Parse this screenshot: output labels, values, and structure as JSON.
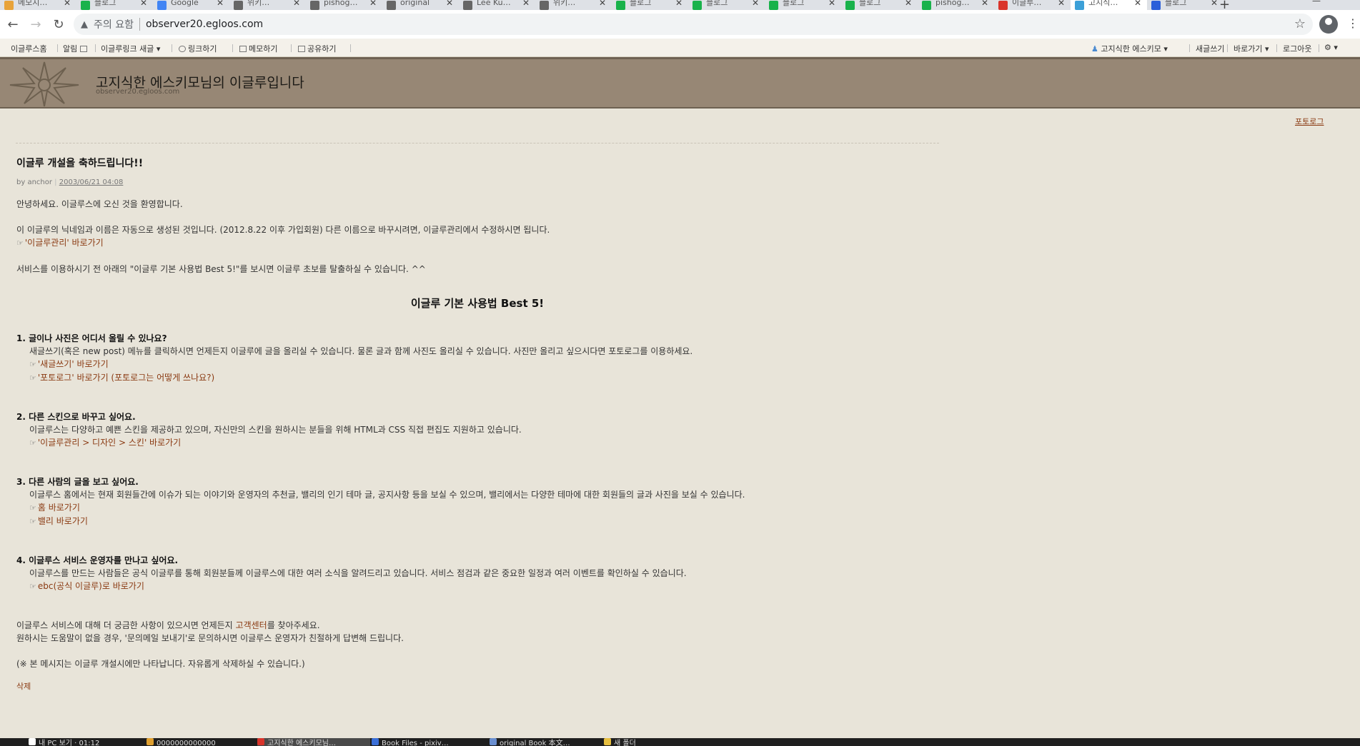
{
  "browser": {
    "tabs": [
      {
        "label": "메모지…",
        "color": "#e8a33a",
        "active": false
      },
      {
        "label": "블로그",
        "color": "#19b24b",
        "active": false
      },
      {
        "label": "Google",
        "color": "#4285f4",
        "active": false
      },
      {
        "label": "위키…",
        "color": "#666666",
        "active": false
      },
      {
        "label": "pishog…",
        "color": "#666666",
        "active": false
      },
      {
        "label": "original",
        "color": "#666666",
        "active": false
      },
      {
        "label": "Lee Ku…",
        "color": "#666666",
        "active": false
      },
      {
        "label": "위키…",
        "color": "#666666",
        "active": false
      },
      {
        "label": "블로그",
        "color": "#19b24b",
        "active": false
      },
      {
        "label": "블로그",
        "color": "#19b24b",
        "active": false
      },
      {
        "label": "블로그",
        "color": "#19b24b",
        "active": false
      },
      {
        "label": "블로그",
        "color": "#19b24b",
        "active": false
      },
      {
        "label": "pishog…",
        "color": "#19b24b",
        "active": false
      },
      {
        "label": "이글루…",
        "color": "#d9342b",
        "active": false
      },
      {
        "label": "고지식…",
        "color": "#3ca0d8",
        "active": true
      },
      {
        "label": "블로그",
        "color": "#2b5fd9",
        "active": false
      }
    ],
    "security_label": "주의 요함",
    "url": "observer20.egloos.com"
  },
  "egloos_bar": {
    "left": [
      "이글루스홈",
      "알림",
      "이글루링크 새글 ▾",
      "링크하기",
      "메모하기",
      "공유하기"
    ],
    "right": [
      "고지식한 에스키모 ▾",
      "새글쓰기",
      "바로가기 ▾",
      "로그아웃",
      "⚙ ▾"
    ]
  },
  "blog": {
    "title": "고지식한 에스키모님의 이글루입니다",
    "subtitle": "observer20.egloos.com",
    "right_link": "포토로그"
  },
  "post": {
    "title": "이글루 개설을 축하드립니다!!",
    "meta_by": "by anchor",
    "meta_date": "2003/06/21 04:08",
    "intro": "안녕하세요. 이글루스에 오신 것을 환영합니다.",
    "nick_note": "이 이글루의 닉네임과 이름은 자동으로 생성된 것입니다. (2012.8.22 이후 가입회원) 다른 이름으로 바꾸시려면, 이글루관리에서 수정하시면 됩니다.",
    "nick_link": "'이글루관리' 바로가기",
    "service_note": "서비스를 이용하시기 전 아래의 \"이글루 기본 사용법 Best 5!\"를 보시면 이글루 초보를 탈출하실 수 있습니다. ^^",
    "best_title": "이글루 기본 사용법 Best 5!",
    "sections": [
      {
        "title": "1. 글이나 사진은 어디서 올릴 수 있나요?",
        "body": "새글쓰기(혹은 new post) 메뉴를 클릭하시면 언제든지 이글루에 글을 올리실 수 있습니다. 물론 글과 함께 사진도 올리실 수 있습니다. 사진만 올리고 싶으시다면 포토로그를 이용하세요.",
        "links": [
          "'새글쓰기' 바로가기",
          "'포토로그' 바로가기 (포토로그는 어떻게 쓰나요?)"
        ]
      },
      {
        "title": "2. 다른 스킨으로 바꾸고 싶어요.",
        "body": "이글루스는 다양하고 예쁜 스킨을 제공하고 있으며, 자신만의 스킨을 원하시는 분들을 위해 HTML과 CSS 직접 편집도 지원하고 있습니다.",
        "links": [
          "'이글루관리 > 디자인 > 스킨' 바로가기"
        ]
      },
      {
        "title": "3. 다른 사람의 글을 보고 싶어요.",
        "body": "이글루스 홈에서는 현재 회원들간에 이슈가 되는 이야기와 운영자의 추천글, 밸리의 인기 테마 글, 공지사항 등을 보실 수 있으며, 밸리에서는 다양한 테마에 대한 회원들의 글과 사진을 보실 수 있습니다.",
        "links": [
          "홈 바로가기",
          "밸리 바로가기"
        ]
      },
      {
        "title": "4. 이글루스 서비스 운영자를 만나고 싶어요.",
        "body": "이글루스를 만드는 사람들은 공식 이글루를 통해 회원분들께 이글루스에 대한 여러 소식을 알려드리고 있습니다. 서비스 점검과 같은 중요한 일정과 여러 이벤트를 확인하실 수 있습니다.",
        "links": [
          "ebc(공식 이글루)로 바로가기"
        ]
      }
    ],
    "closing1_pre": "이글루스 서비스에 대해 더 궁금한 사항이 있으시면 언제든지 ",
    "closing1_link": "고객센터",
    "closing1_post": "를 찾아주세요.",
    "closing2": "원하시는 도움말이 없을 경우, '문의메일 보내기'로 문의하시면 이글루스 운영자가 친절하게 답변해 드립니다.",
    "closing3": "(※ 본 메시지는 이글루 개설시에만 나타납니다. 자유롭게 삭제하실 수 있습니다.)",
    "delete_label": "삭제"
  },
  "taskbar": {
    "items": [
      {
        "label": "내 PC 보기 · 01:12",
        "color": "#ffffff"
      },
      {
        "label": "0000000000000",
        "color": "#e0a030"
      },
      {
        "label": "고지식한 에스키모님…",
        "color": "#d9342b"
      },
      {
        "label": "Book Files - pixiv…",
        "color": "#3a6fd8"
      },
      {
        "label": "original Book 本文…",
        "color": "#6a8fd0"
      },
      {
        "label": "새 폴더",
        "color": "#e8c040"
      }
    ]
  }
}
